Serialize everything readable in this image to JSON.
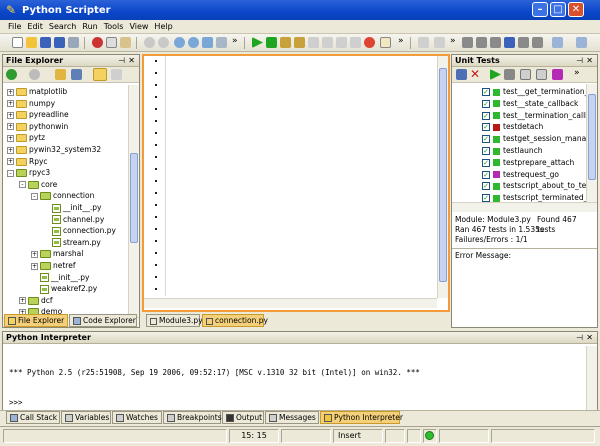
{
  "window": {
    "title": "Python Scripter"
  },
  "menu": [
    "File",
    "Edit",
    "Search",
    "Run",
    "Tools",
    "View",
    "Help"
  ],
  "file_explorer": {
    "title": "File Explorer",
    "tree": [
      {
        "label": "matplotlib",
        "depth": 0,
        "kind": "folder",
        "exp": "+"
      },
      {
        "label": "numpy",
        "depth": 0,
        "kind": "folder",
        "exp": "+"
      },
      {
        "label": "pyreadline",
        "depth": 0,
        "kind": "folder",
        "exp": "+"
      },
      {
        "label": "pythonwin",
        "depth": 0,
        "kind": "folder",
        "exp": "+"
      },
      {
        "label": "pytz",
        "depth": 0,
        "kind": "folder",
        "exp": "+"
      },
      {
        "label": "pywin32_system32",
        "depth": 0,
        "kind": "folder",
        "exp": "+"
      },
      {
        "label": "Rpyc",
        "depth": 0,
        "kind": "folder",
        "exp": "+"
      },
      {
        "label": "rpyc3",
        "depth": 0,
        "kind": "pkg",
        "exp": "-"
      },
      {
        "label": "core",
        "depth": 1,
        "kind": "pkg",
        "exp": "-"
      },
      {
        "label": "connection",
        "depth": 2,
        "kind": "pkg",
        "exp": "-"
      },
      {
        "label": "__init__.py",
        "depth": 3,
        "kind": "py",
        "exp": ""
      },
      {
        "label": "channel.py",
        "depth": 3,
        "kind": "py",
        "exp": ""
      },
      {
        "label": "connection.py",
        "depth": 3,
        "kind": "py",
        "exp": ""
      },
      {
        "label": "stream.py",
        "depth": 3,
        "kind": "py",
        "exp": ""
      },
      {
        "label": "marshal",
        "depth": 2,
        "kind": "pkg",
        "exp": "+"
      },
      {
        "label": "netref",
        "depth": 2,
        "kind": "pkg",
        "exp": "+"
      },
      {
        "label": "__init__.py",
        "depth": 2,
        "kind": "py",
        "exp": ""
      },
      {
        "label": "weakref2.py",
        "depth": 2,
        "kind": "py",
        "exp": ""
      },
      {
        "label": "dcf",
        "depth": 1,
        "kind": "pkg",
        "exp": "+"
      },
      {
        "label": "demo",
        "depth": 1,
        "kind": "pkg",
        "exp": "+"
      }
    ]
  },
  "left_tabs": [
    "File Explorer",
    "Code Explorer"
  ],
  "editor_tabs": [
    "Module3.py",
    "connection.py"
  ],
  "unit_tests": {
    "title": "Unit Tests",
    "tests": [
      {
        "name": "test__get_termination_",
        "status": "#2eb82e"
      },
      {
        "name": "test__state_callback",
        "status": "#2eb82e"
      },
      {
        "name": "test__termination_callba",
        "status": "#2eb82e"
      },
      {
        "name": "testdetach",
        "status": "#b81818"
      },
      {
        "name": "testget_session_manage",
        "status": "#2eb82e"
      },
      {
        "name": "testlaunch",
        "status": "#2eb82e"
      },
      {
        "name": "testprepare_attach",
        "status": "#2eb82e"
      },
      {
        "name": "testrequest_go",
        "status": "#b52ab5"
      },
      {
        "name": "testscript_about_to_ter",
        "status": "#2eb82e"
      },
      {
        "name": "testscript_terminated_c",
        "status": "#2eb82e"
      }
    ],
    "summary": {
      "module": "Module: Module3.py",
      "found": "Found 467 tests",
      "ran": "Ran 467 tests in 1.535s",
      "failures": "Failures/Errors : 1/1"
    },
    "error_label": "Error Message:"
  },
  "interpreter": {
    "title": "Python Interpreter",
    "lines": [
      "*** Python 2.5 (r25:51908, Sep 19 2006, 09:52:17) [MSC v.1310 32 bit (Intel)] on win32. ***",
      ">>>"
    ]
  },
  "bottom_tabs": [
    "Call Stack",
    "Variables",
    "Watches",
    "Breakpoints",
    "Output",
    "Messages",
    "Python Interpreter"
  ],
  "status": {
    "position": "15: 15",
    "mode": "Insert"
  }
}
